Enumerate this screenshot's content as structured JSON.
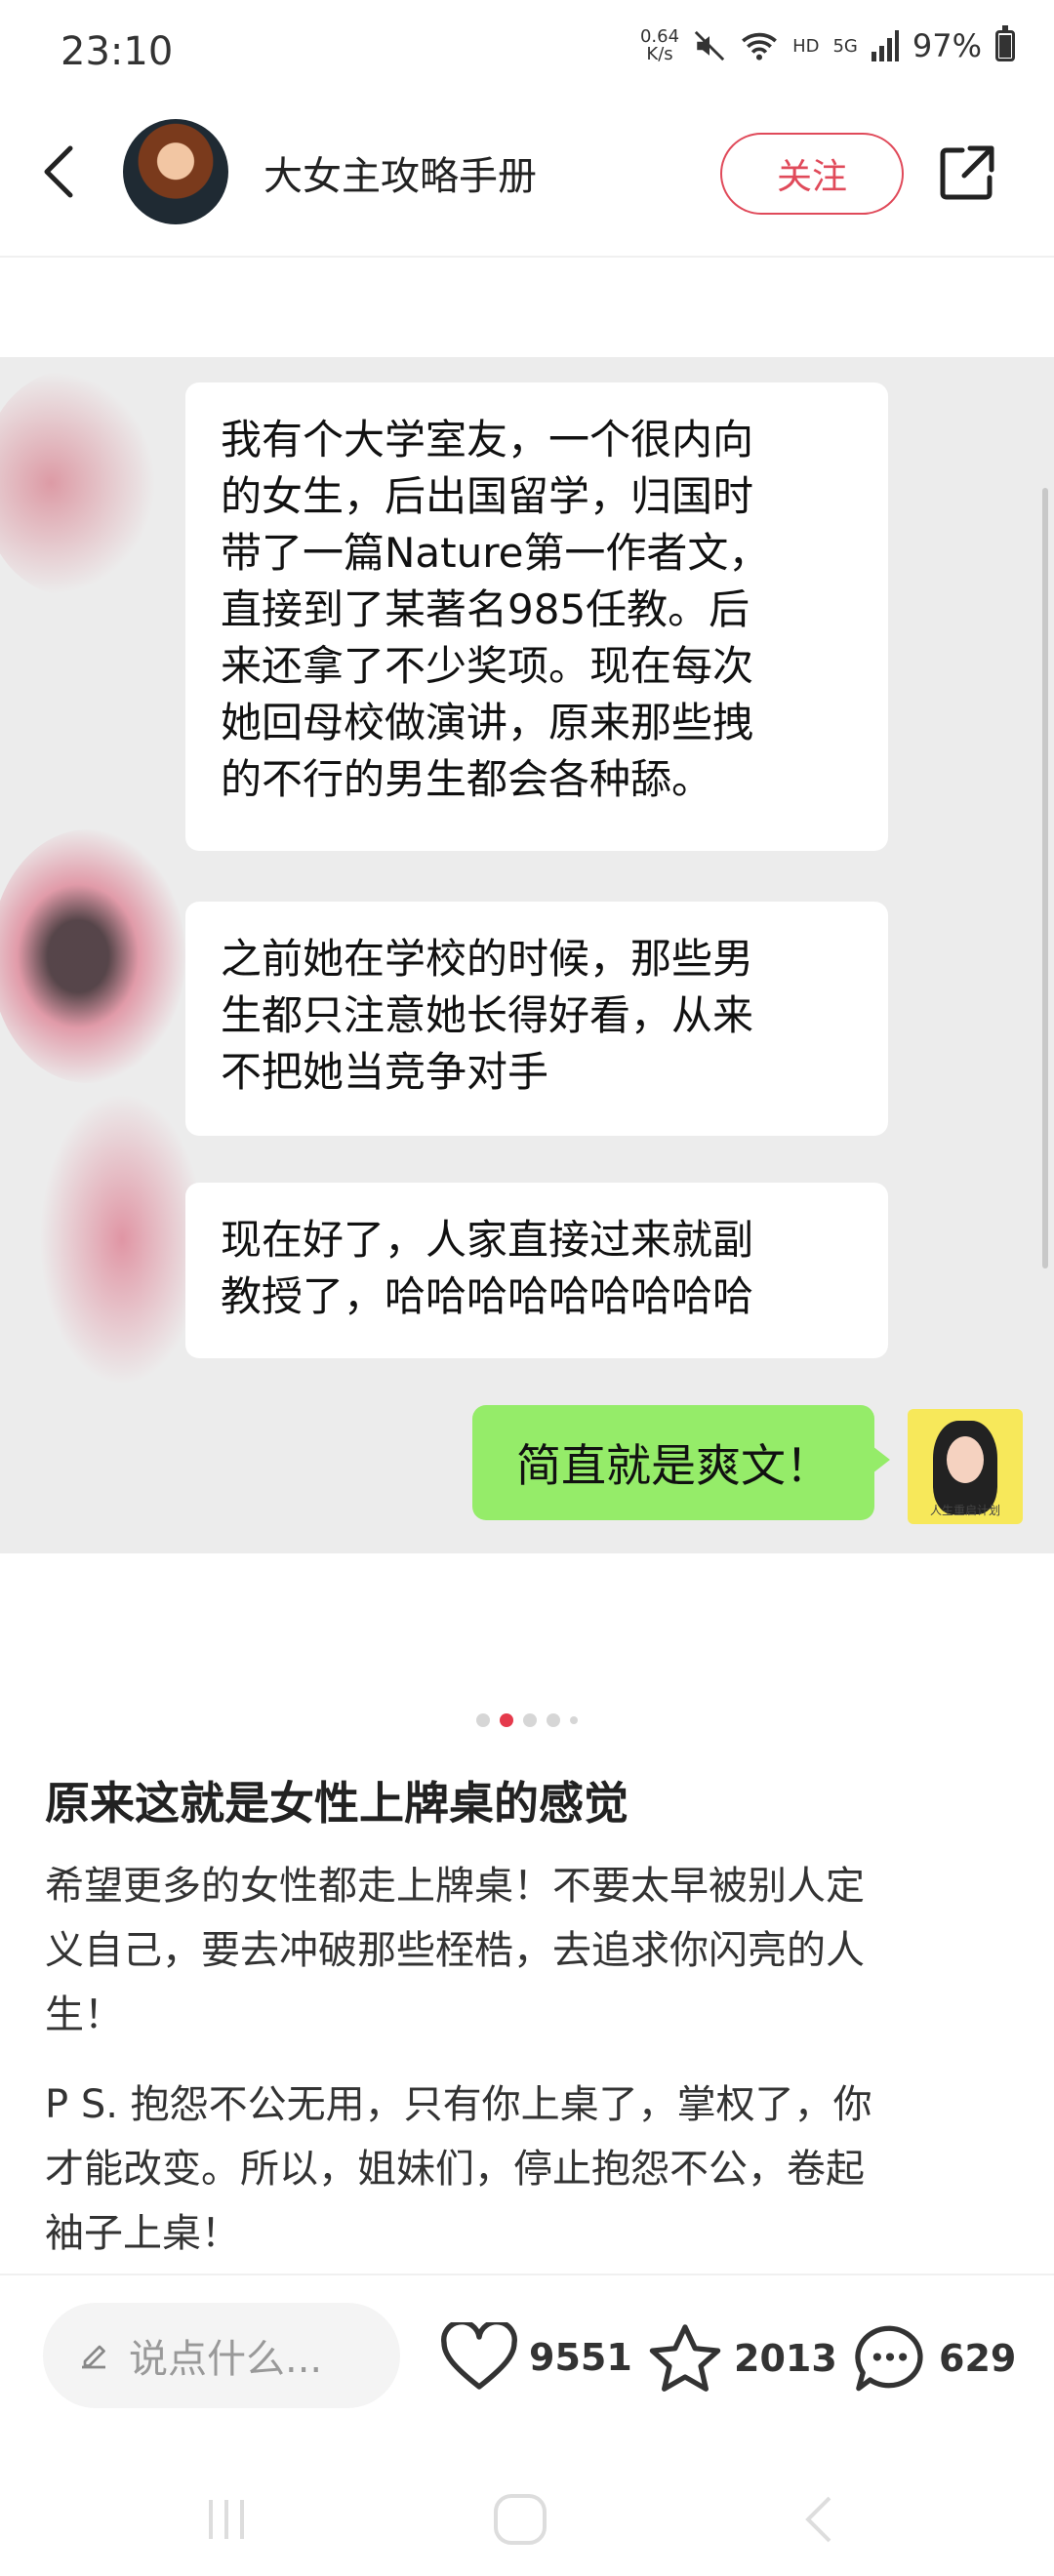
{
  "status_bar": {
    "time": "23:10",
    "net_speed_value": "0.64",
    "net_speed_unit": "K/s",
    "signal_label": "HD",
    "network": "5G",
    "battery": "97%"
  },
  "header": {
    "author_name": "大女主攻略手册",
    "follow_label": "关注"
  },
  "chat": {
    "bubble1": [
      "我有个大学室友，一个很内向",
      "的女生，后出国留学，归国时",
      "带了一篇Nature第一作者文，",
      "直接到了某著名985任教。后",
      "来还拿了不少奖项。现在每次",
      "她回母校做演讲，原来那些拽",
      "的不行的男生都会各种舔。"
    ],
    "bubble2": [
      "之前她在学校的时候，那些男",
      "生都只注意她长得好看，从来",
      "不把她当竞争对手"
    ],
    "bubble3": [
      "现在好了，人家直接过来就副",
      "教授了，哈哈哈哈哈哈哈哈哈"
    ],
    "reply": "简直就是爽文！",
    "avatar_caption": "人生重启计划"
  },
  "carousel": {
    "count": 5,
    "active_index": 1
  },
  "post": {
    "title": "原来这就是女性上牌桌的感觉",
    "para1": [
      "希望更多的女性都走上牌桌！不要太早被别人定",
      "义自己，要去冲破那些桎梏，去追求你闪亮的人",
      "生！"
    ],
    "para2": [
      "P S. 抱怨不公无用，只有你上桌了，掌权了，你",
      "才能改变。所以，姐妹们，停止抱怨不公，卷起",
      "袖子上桌！"
    ]
  },
  "actions": {
    "comment_placeholder": "说点什么...",
    "likes": "9551",
    "favorites": "2013",
    "comments": "629"
  },
  "colors": {
    "accent": "#e04a5a",
    "chat_bg": "#ececec",
    "reply_bubble": "#95ec69"
  },
  "icons": [
    "back-icon",
    "share-icon",
    "pencil-icon",
    "heart-icon",
    "star-icon",
    "comment-icon"
  ]
}
